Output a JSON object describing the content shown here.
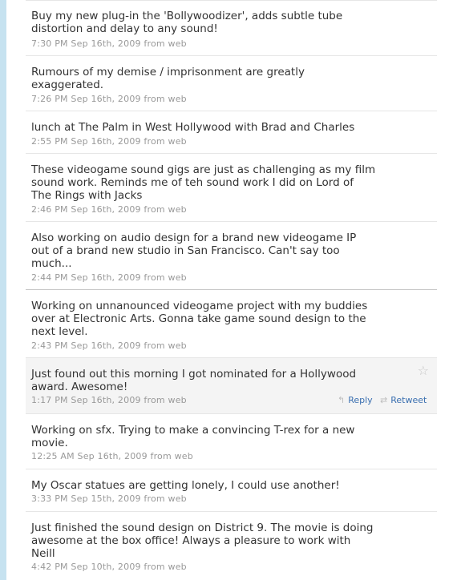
{
  "timeline": {
    "tweets": [
      {
        "text": "Buy my new plug-in the 'Bollywoodizer', adds subtle tube distortion and delay to any sound!",
        "meta": "7:30 PM Sep 16th, 2009 from web"
      },
      {
        "text": "Rumours of my demise / imprisonment are greatly exaggerated.",
        "meta": "7:26 PM Sep 16th, 2009 from web"
      },
      {
        "text": "lunch at The Palm in West Hollywood with Brad and Charles",
        "meta": "2:55 PM Sep 16th, 2009 from web"
      },
      {
        "text": "These videogame sound gigs are just as challenging as my film sound work. Reminds me of teh sound work I did on Lord of The Rings with Jacks",
        "meta": "2:46 PM Sep 16th, 2009 from web"
      },
      {
        "text": "Also working on audio design for a brand new videogame IP out of a brand new studio in San Francisco. Can't say too much...",
        "meta": "2:44 PM Sep 16th, 2009 from web"
      },
      {
        "text": "Working on unnanounced videogame project with my buddies over at Electronic Arts. Gonna take game sound design to the next level.",
        "meta": "2:43 PM Sep 16th, 2009 from web"
      },
      {
        "text": "Just found out this morning I got nominated for a Hollywood award. Awesome!",
        "meta": "1:17 PM Sep 16th, 2009 from web",
        "reply_label": "Reply",
        "retweet_label": "Retweet"
      },
      {
        "text": "Working on sfx. Trying to make a convincing T-rex for a new movie.",
        "meta": "12:25 AM Sep 16th, 2009 from web"
      },
      {
        "text": "My Oscar statues are getting lonely, I could use another!",
        "meta": "3:33 PM Sep 15th, 2009 from web"
      },
      {
        "text": "Just finished the sound design on District 9. The movie is doing awesome at the box office! Always a pleasure to work with Neill",
        "meta": "4:42 PM Sep 10th, 2009 from web"
      }
    ]
  },
  "icons": {
    "favorite": "star-outline-icon",
    "reply": "reply-arrow-icon",
    "retweet": "retweet-icon"
  },
  "colors": {
    "text": "#333333",
    "meta": "#999999",
    "link": "#3a6fb0",
    "hover_bg": "#f4f4f4",
    "sidebar_strip": "#c6e2f0"
  }
}
